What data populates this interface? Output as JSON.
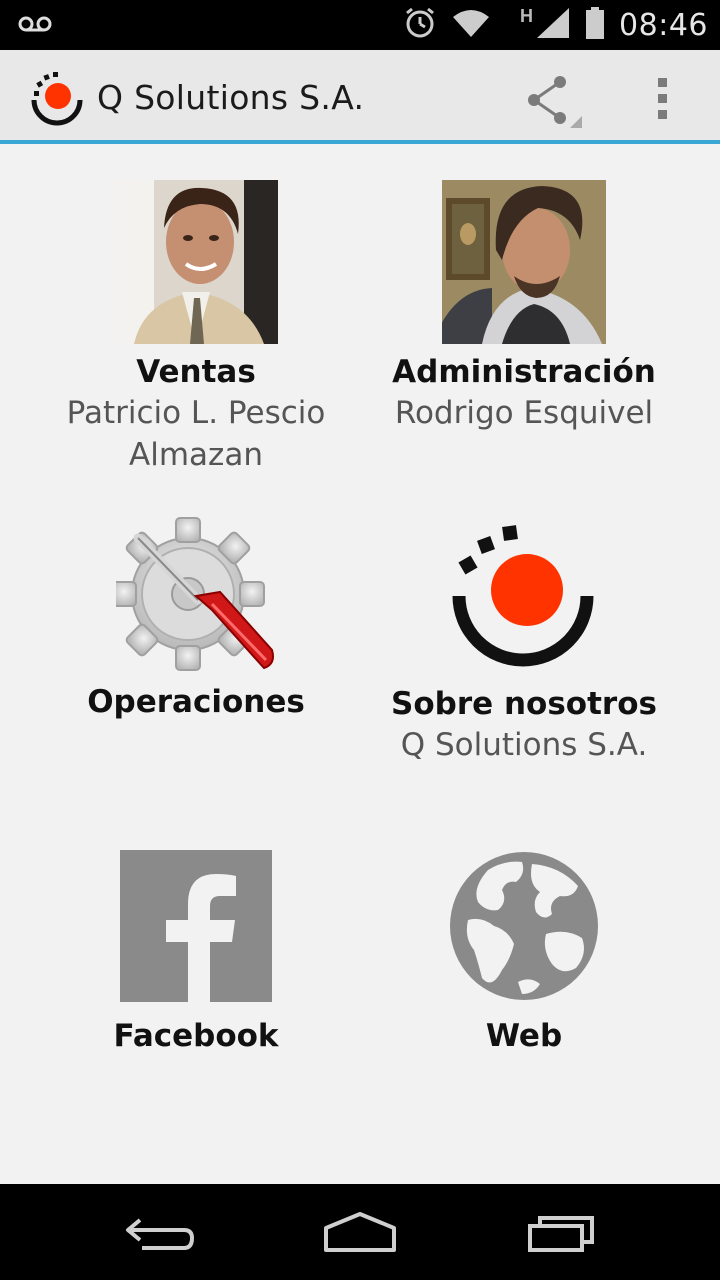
{
  "status_bar": {
    "time": "08:46",
    "network_type": "H",
    "icons": [
      "voicemail-icon",
      "alarm-icon",
      "wifi-icon",
      "signal-icon",
      "battery-icon"
    ]
  },
  "action_bar": {
    "title": "Q Solutions S.A.",
    "logo": "q-solutions-logo",
    "actions": [
      "share-icon",
      "overflow-menu-icon"
    ]
  },
  "colors": {
    "accent_blue": "#39a6d6",
    "logo_red": "#ff3300",
    "icon_gray": "#8a8a8a"
  },
  "grid": {
    "ventas": {
      "title": "Ventas",
      "subtitle": "Patricio L. Pescio Almazan"
    },
    "administracion": {
      "title": "Administración",
      "subtitle": "Rodrigo Esquivel"
    },
    "operaciones": {
      "title": "Operaciones"
    },
    "sobre_nosotros": {
      "title": "Sobre nosotros",
      "subtitle": "Q Solutions S.A."
    },
    "facebook": {
      "title": "Facebook"
    },
    "web": {
      "title": "Web"
    }
  },
  "nav_bar": {
    "buttons": [
      "back-icon",
      "home-icon",
      "recent-apps-icon"
    ]
  }
}
